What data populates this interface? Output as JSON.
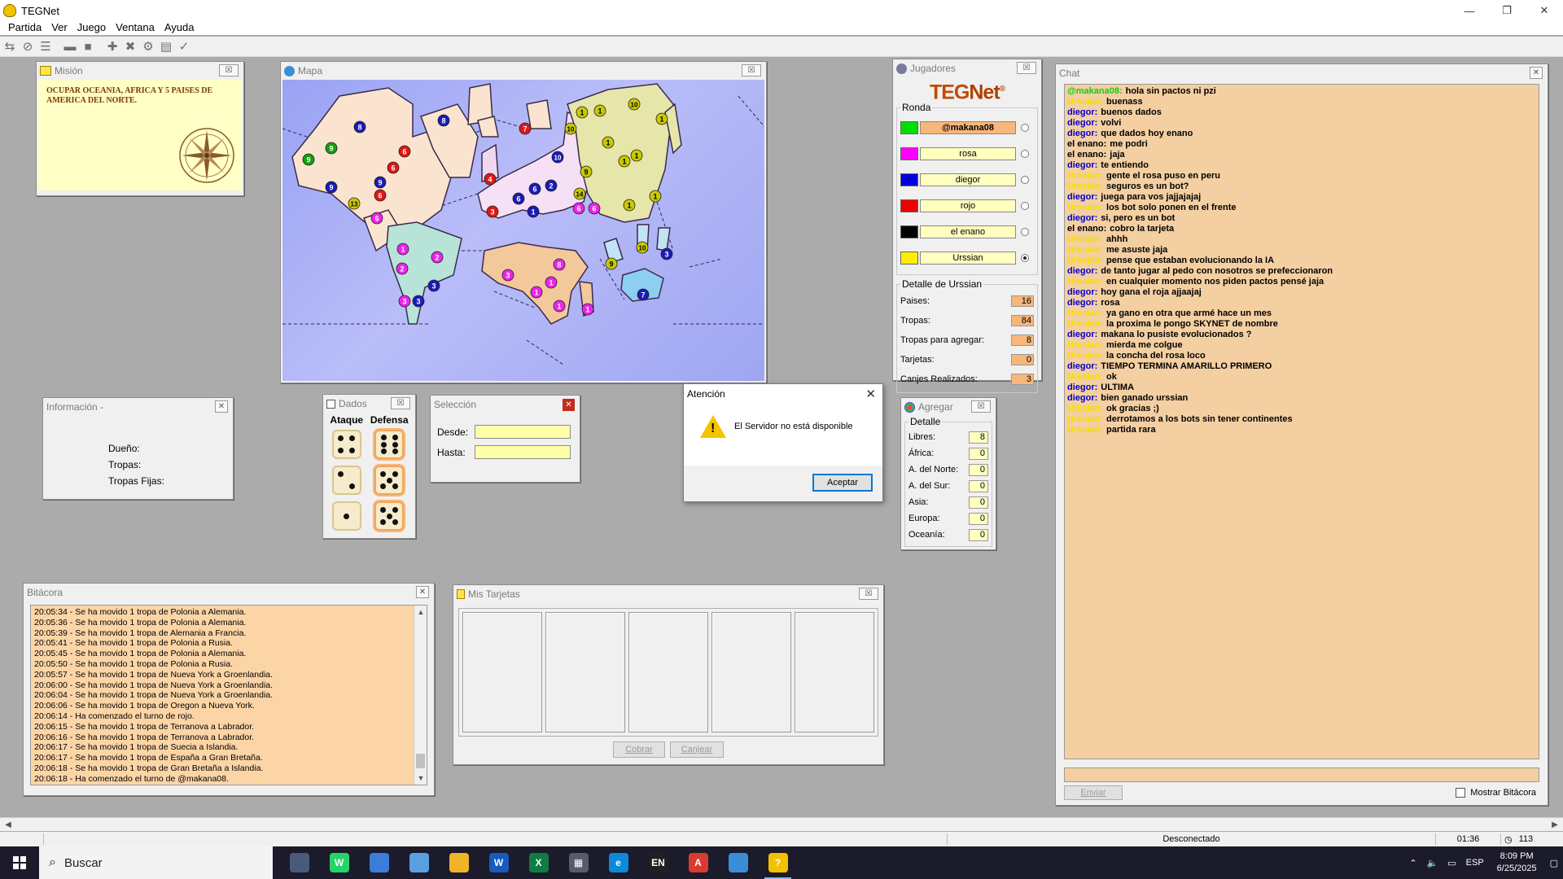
{
  "window": {
    "title": "TEGNet",
    "min": "—",
    "max": "❐",
    "close": "✕"
  },
  "menu": [
    "Partida",
    "Ver",
    "Juego",
    "Ventana",
    "Ayuda"
  ],
  "toolbar_icons": [
    "connect-icon",
    "disconnect-icon",
    "list-icon",
    "panel1-icon",
    "panel2-icon",
    "add-icon",
    "cancel-icon",
    "gear-icon",
    "card-icon",
    "check-icon"
  ],
  "mission": {
    "title": "Misión",
    "close": "☒",
    "text": "OCUPAR OCEANIA, AFRICA Y 5 PAISES DE AMERICA DEL NORTE."
  },
  "map": {
    "title": "Mapa",
    "close": "☒",
    "tokens": [
      {
        "c": "#1b1bb8",
        "n": "8"
      },
      {
        "c": "#1b1bb8",
        "n": "8"
      },
      {
        "c": "#e01616",
        "n": "6"
      },
      {
        "c": "#e01616",
        "n": "7"
      },
      {
        "c": "#12a012",
        "n": "9"
      },
      {
        "c": "#12a012",
        "n": "9"
      },
      {
        "c": "#e01616",
        "n": "6"
      },
      {
        "c": "#e01616",
        "n": "6"
      },
      {
        "c": "#1b1bb8",
        "n": "9"
      },
      {
        "c": "#1b1bb8",
        "n": "9"
      },
      {
        "c": "#c9c900",
        "n": "13"
      },
      {
        "c": "#ee22ee",
        "n": "6"
      },
      {
        "c": "#e01616",
        "n": "4"
      },
      {
        "c": "#e01616",
        "n": "3"
      },
      {
        "c": "#1b1bb8",
        "n": "10"
      },
      {
        "c": "#1b1bb8",
        "n": "6"
      },
      {
        "c": "#1b1bb8",
        "n": "6"
      },
      {
        "c": "#1b1bb8",
        "n": "2"
      },
      {
        "c": "#1b1bb8",
        "n": "1"
      },
      {
        "c": "#ee22ee",
        "n": "6"
      },
      {
        "c": "#ee22ee",
        "n": "6"
      },
      {
        "c": "#c9c900",
        "n": "14"
      },
      {
        "c": "#c9c900",
        "n": "1"
      },
      {
        "c": "#c9c900",
        "n": "1"
      },
      {
        "c": "#c9c900",
        "n": "10"
      },
      {
        "c": "#c9c900",
        "n": "10"
      },
      {
        "c": "#c9c900",
        "n": "1"
      },
      {
        "c": "#c9c900",
        "n": "1"
      },
      {
        "c": "#c9c900",
        "n": "1"
      },
      {
        "c": "#c9c900",
        "n": "9"
      },
      {
        "c": "#c9c900",
        "n": "1"
      },
      {
        "c": "#c9c900",
        "n": "1"
      },
      {
        "c": "#c9c900",
        "n": "1"
      },
      {
        "c": "#ee22ee",
        "n": "1"
      },
      {
        "c": "#ee22ee",
        "n": "2"
      },
      {
        "c": "#ee22ee",
        "n": "2"
      },
      {
        "c": "#ee22ee",
        "n": "3"
      },
      {
        "c": "#1b1bb8",
        "n": "3"
      },
      {
        "c": "#1b1bb8",
        "n": "3"
      },
      {
        "c": "#ee22ee",
        "n": "3"
      },
      {
        "c": "#ee22ee",
        "n": "8"
      },
      {
        "c": "#ee22ee",
        "n": "1"
      },
      {
        "c": "#ee22ee",
        "n": "1"
      },
      {
        "c": "#ee22ee",
        "n": "1"
      },
      {
        "c": "#ee22ee",
        "n": "1"
      },
      {
        "c": "#c9c900",
        "n": "9"
      },
      {
        "c": "#c9c900",
        "n": "10"
      },
      {
        "c": "#1b1bb8",
        "n": "3"
      },
      {
        "c": "#1b1bb8",
        "n": "7"
      }
    ]
  },
  "players": {
    "title": "Jugadores",
    "close": "☒",
    "logo_a": "TEG",
    "logo_b": "Net",
    "logo_mark": "®",
    "round_label": "Ronda",
    "list": [
      {
        "name": "@makana08",
        "color": "#00dd00",
        "active": true
      },
      {
        "name": "rosa",
        "color": "#ff00ff",
        "active": false
      },
      {
        "name": "diegor",
        "color": "#0000dd",
        "active": false
      },
      {
        "name": "rojo",
        "color": "#ee0000",
        "active": false
      },
      {
        "name": "el enano",
        "color": "#000000",
        "active": false
      },
      {
        "name": "Urssian",
        "color": "#ffee00",
        "active": false,
        "checked": true
      }
    ],
    "detail_label": "Detalle de Urssian",
    "detail": [
      {
        "label": "Paises:",
        "value": "16"
      },
      {
        "label": "Tropas:",
        "value": "84"
      },
      {
        "label": "Tropas para agregar:",
        "value": "8"
      },
      {
        "label": "Tarjetas:",
        "value": "0"
      },
      {
        "label": "Canjes Realizados:",
        "value": "3"
      }
    ]
  },
  "info": {
    "title": "Información -",
    "close": "✕",
    "owner": "Dueño:",
    "troops": "Tropas:",
    "fixed": "Tropas Fijas:"
  },
  "dados": {
    "title": "Dados",
    "close": "☒",
    "attack": "Ataque",
    "defense": "Defensa",
    "attack_vals": [
      4,
      2,
      1
    ],
    "defense_vals": [
      6,
      5,
      5
    ]
  },
  "seleccion": {
    "title": "Selección",
    "close": "✕",
    "from": "Desde:",
    "to": "Hasta:"
  },
  "agregar": {
    "title": "Agregar",
    "close": "☒",
    "detail_label": "Detalle",
    "rows": [
      {
        "label": "Libres:",
        "value": "8"
      },
      {
        "label": "África:",
        "value": "0"
      },
      {
        "label": "A. del Norte:",
        "value": "0"
      },
      {
        "label": "A. del Sur:",
        "value": "0"
      },
      {
        "label": "Asia:",
        "value": "0"
      },
      {
        "label": "Europa:",
        "value": "0"
      },
      {
        "label": "Oceanía:",
        "value": "0"
      }
    ]
  },
  "dialog": {
    "title": "Atención",
    "close": "✕",
    "message": "El Servidor no está disponible",
    "ok": "Aceptar"
  },
  "log": {
    "title": "Bitácora",
    "close": "✕",
    "up": "▲",
    "down": "▼",
    "lines": [
      "20:05:34 - Se ha movido 1 tropa de Polonia a Alemania.",
      "20:05:36 - Se ha movido 1 tropa de Polonia a Alemania.",
      "20:05:39 - Se ha movido 1 tropa de Alemania a Francia.",
      "20:05:41 - Se ha movido 1 tropa de Polonia a Rusia.",
      "20:05:45 - Se ha movido 1 tropa de Polonia a Alemania.",
      "20:05:50 - Se ha movido 1 tropa de Polonia a Rusia.",
      "20:05:57 - Se ha movido 1 tropa de Nueva York a Groenlandia.",
      "20:06:00 - Se ha movido 1 tropa de Nueva York a Groenlandia.",
      "20:06:04 - Se ha movido 1 tropa de Nueva York a Groenlandia.",
      "20:06:06 - Se ha movido 1 tropa de Oregon a Nueva York.",
      "20:06:14 - Ha comenzado el turno de rojo.",
      "20:06:15 - Se ha movido 1 tropa de Terranova a Labrador.",
      "20:06:16 - Se ha movido 1 tropa de Terranova a Labrador.",
      "20:06:17 - Se ha movido 1 tropa de Suecia a Islandia.",
      "20:06:17 - Se ha movido 1 tropa de España a Gran Bretaña.",
      "20:06:18 - Se ha movido 1 tropa de Gran Bretaña a Islandia.",
      "20:06:18 - Ha comenzado el turno de @makana08."
    ]
  },
  "cards": {
    "title": "Mis Tarjetas",
    "close": "☒",
    "cobrar": "Cobrar",
    "canjear": "Canjear"
  },
  "chat": {
    "title": "Chat",
    "close": "✕",
    "send": "Enviar",
    "show_log": "Mostrar Bitácora",
    "lines": [
      {
        "who": "@makana08:",
        "color": "#11cc11",
        "text": "hola sin pactos ni pzi"
      },
      {
        "who": "Urssian:",
        "color": "#f0e000",
        "text": "buenass"
      },
      {
        "who": "diegor:",
        "color": "#0000cc",
        "text": "buenos dados"
      },
      {
        "who": "diegor:",
        "color": "#0000cc",
        "text": "volvi"
      },
      {
        "who": "diegor:",
        "color": "#0000cc",
        "text": "que dados hoy enano"
      },
      {
        "who": "el enano:",
        "color": "#000000",
        "text": "me podri"
      },
      {
        "who": "el enano:",
        "color": "#000000",
        "text": "jaja"
      },
      {
        "who": "diegor:",
        "color": "#0000cc",
        "text": "te entiendo"
      },
      {
        "who": "Urssian:",
        "color": "#f0e000",
        "text": "gente el rosa puso en peru"
      },
      {
        "who": "Urssian:",
        "color": "#f0e000",
        "text": "seguros es un bot?"
      },
      {
        "who": "diegor:",
        "color": "#0000cc",
        "text": "juega para vos jajjajajaj"
      },
      {
        "who": "Urssian:",
        "color": "#f0e000",
        "text": "los bot solo ponen en el frente"
      },
      {
        "who": "diegor:",
        "color": "#0000cc",
        "text": "si, pero es un bot"
      },
      {
        "who": "el enano:",
        "color": "#000000",
        "text": "cobro la tarjeta"
      },
      {
        "who": "Urssian:",
        "color": "#f0e000",
        "text": "ahhh"
      },
      {
        "who": "Urssian:",
        "color": "#f0e000",
        "text": "me asuste jaja"
      },
      {
        "who": "Urssian:",
        "color": "#f0e000",
        "text": "pense que estaban evolucionando la IA"
      },
      {
        "who": "diegor:",
        "color": "#0000cc",
        "text": "de tanto jugar al pedo con nosotros se prefeccionaron"
      },
      {
        "who": "Urssian:",
        "color": "#f0e000",
        "text": "en cualquier momento nos piden pactos pensé jaja"
      },
      {
        "who": "diegor:",
        "color": "#0000cc",
        "text": "hoy gana el roja ajjaajaj"
      },
      {
        "who": "diegor:",
        "color": "#0000cc",
        "text": "rosa"
      },
      {
        "who": "Urssian:",
        "color": "#f0e000",
        "text": "ya gano en otra que armé hace un mes"
      },
      {
        "who": "Urssian:",
        "color": "#f0e000",
        "text": "la proxima le pongo SKYNET de nombre"
      },
      {
        "who": "diegor:",
        "color": "#0000cc",
        "text": "makana lo pusiste evolucionados ?"
      },
      {
        "who": "Urssian:",
        "color": "#f0e000",
        "text": "mierda me colgue"
      },
      {
        "who": "Urssian:",
        "color": "#f0e000",
        "text": "la concha del rosa loco"
      },
      {
        "who": "diegor:",
        "color": "#0000cc",
        "text": "TIEMPO TERMINA AMARILLO PRIMERO"
      },
      {
        "who": "Urssian:",
        "color": "#f0e000",
        "text": "ok"
      },
      {
        "who": "diegor:",
        "color": "#0000cc",
        "text": "ULTIMA"
      },
      {
        "who": "diegor:",
        "color": "#0000cc",
        "text": "bien ganado urssian"
      },
      {
        "who": "Urssian:",
        "color": "#f0e000",
        "text": "ok gracias ;)"
      },
      {
        "who": "Urssian:",
        "color": "#f0e000",
        "text": "derrotamos a los bots sin tener continentes"
      },
      {
        "who": "Urssian:",
        "color": "#f0e000",
        "text": "partida rara"
      }
    ]
  },
  "statusbar": {
    "status": "Desconectado",
    "time": "01:36",
    "count": "113",
    "left": "◀",
    "right": "▶"
  },
  "taskbar": {
    "search": "Buscar",
    "apps": [
      {
        "name": "explorer-weather-icon",
        "color": "#4a5a7a",
        "label": "",
        "active": false
      },
      {
        "name": "whatsapp-icon",
        "color": "#25d366",
        "label": "W",
        "active": false
      },
      {
        "name": "globe-icon",
        "color": "#3b7dd8",
        "label": "",
        "active": false
      },
      {
        "name": "notes-icon",
        "color": "#5aa0e0",
        "label": "",
        "active": false
      },
      {
        "name": "folder-icon",
        "color": "#f0b429",
        "label": "",
        "active": false
      },
      {
        "name": "word-icon",
        "color": "#185abd",
        "label": "W",
        "active": false
      },
      {
        "name": "excel-icon",
        "color": "#107c41",
        "label": "X",
        "active": false
      },
      {
        "name": "calculator-icon",
        "color": "#5a5a6a",
        "label": "▦",
        "active": false
      },
      {
        "name": "edge-icon",
        "color": "#0c8ad8",
        "label": "e",
        "active": false
      },
      {
        "name": "en-icon",
        "color": "#202020",
        "label": "EN",
        "active": false
      },
      {
        "name": "pdf-icon",
        "color": "#d83b2f",
        "label": "A",
        "active": false
      },
      {
        "name": "teg-globe-icon",
        "color": "#3a8ed8",
        "label": "",
        "active": false
      },
      {
        "name": "tegnet-icon",
        "color": "#f2c100",
        "label": "?",
        "active": true
      }
    ],
    "lang": "ESP",
    "time": "8:09 PM",
    "date": "6/25/2025"
  }
}
